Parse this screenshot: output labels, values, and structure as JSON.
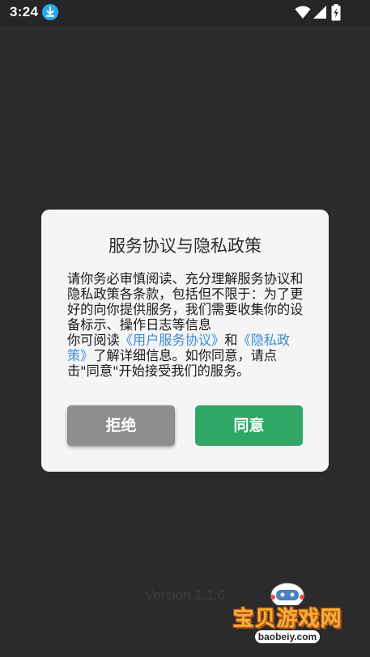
{
  "status_bar": {
    "time": "3:24",
    "icons": [
      "download-icon",
      "wifi-icon",
      "signal-icon",
      "battery-icon"
    ]
  },
  "dialog": {
    "title": "服务协议与隐私政策",
    "body": {
      "paragraph1": "请你务必审慎阅读、充分理解服务协议和隐私政策各条款，包括但不限于：为了更好的向你提供服务，我们需要收集你的设备标示、操作日志等信息",
      "p2_prefix": "你可阅读",
      "link_user_agreement": "《用户服务协议》",
      "p2_and": "和",
      "link_privacy_policy": "《隐私政策》",
      "p2_suffix": "了解详细信息。如你同意，请点击\"同意\"开始接受我们的服务。"
    },
    "buttons": {
      "reject_label": "拒绝",
      "agree_label": "同意"
    }
  },
  "footer": {
    "version": "Version 1.1.6"
  },
  "watermark": {
    "text": "宝贝游戏网",
    "url": "baobeiy.com"
  },
  "colors": {
    "background": "#2b2b2b",
    "dialog_background": "#f5f5f5",
    "agree_button": "#2fa866",
    "reject_button": "#8e8e8e",
    "link": "#3b8bd6"
  }
}
